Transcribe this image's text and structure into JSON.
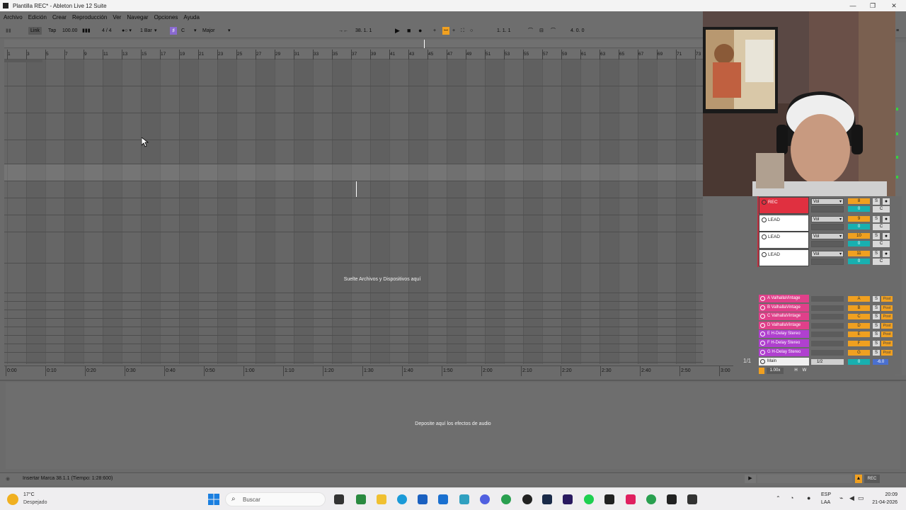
{
  "window": {
    "title": "Plantilla REC* - Ableton Live 12 Suite",
    "controls": [
      "—",
      "❐",
      "✕"
    ]
  },
  "menu": [
    "Archivo",
    "Edición",
    "Crear",
    "Reproducción",
    "Ver",
    "Navegar",
    "Opciones",
    "Ayuda"
  ],
  "control_bar": {
    "link": "Link",
    "tap": "Tap",
    "tempo": "100.00",
    "signature": "4 / 4",
    "quantize": "1 Bar",
    "key": "C",
    "scale": "Major",
    "position": "38.  1.  1",
    "loop_start": "1.  1.  1",
    "loop_length": "4.  0.  0"
  },
  "ruler_ticks": [
    "1",
    "3",
    "5",
    "7",
    "9",
    "11",
    "13",
    "15",
    "17",
    "19",
    "21",
    "23",
    "25",
    "27",
    "29",
    "31",
    "33",
    "35",
    "37",
    "39",
    "41",
    "43",
    "45",
    "47",
    "49",
    "51",
    "53",
    "55",
    "57",
    "59",
    "61",
    "63",
    "65",
    "67",
    "69",
    "71",
    "73"
  ],
  "time_ticks": [
    "0:00",
    "0:10",
    "0:20",
    "0:30",
    "0:40",
    "0:50",
    "1:00",
    "1:10",
    "1:20",
    "1:30",
    "1:40",
    "1:50",
    "2:00",
    "2:10",
    "2:20",
    "2:30",
    "2:40",
    "2:50",
    "3:00"
  ],
  "arrangement": {
    "drop_text": "Suelte Archivos y Dispositivos aquí"
  },
  "tracks": [
    {
      "name": "REC",
      "vol": "Vol",
      "number": "8",
      "value": "0",
      "solo": "S",
      "arm": "●",
      "center": "C",
      "color": "#e03040"
    },
    {
      "name": "LEAD",
      "vol": "Vol",
      "number": "9",
      "value": "0",
      "solo": "S",
      "arm": "●",
      "center": "C",
      "color": "#ffffff"
    },
    {
      "name": "LEAD",
      "vol": "Vol",
      "number": "10",
      "value": "0",
      "solo": "S",
      "arm": "●",
      "center": "C",
      "color": "#ffffff"
    },
    {
      "name": "LEAD",
      "vol": "Vol",
      "number": "11",
      "value": "0",
      "solo": "S",
      "arm": "●",
      "center": "C",
      "color": "#ffffff"
    }
  ],
  "returns": [
    {
      "name": "A ValhallaVintage",
      "letter": "A",
      "solo": "S",
      "post": "Post",
      "color": "#e0408a"
    },
    {
      "name": "B ValhallaVintage",
      "letter": "B",
      "solo": "S",
      "post": "Post",
      "color": "#e0408a"
    },
    {
      "name": "C ValhallaVintage",
      "letter": "C",
      "solo": "S",
      "post": "Post",
      "color": "#e0408a"
    },
    {
      "name": "D ValhallaVintage",
      "letter": "D",
      "solo": "S",
      "post": "Post",
      "color": "#e0408a"
    },
    {
      "name": "E H-Delay Stereo",
      "letter": "E",
      "solo": "S",
      "post": "Post",
      "color": "#b040d0"
    },
    {
      "name": "F H-Delay Stereo",
      "letter": "F",
      "solo": "S",
      "post": "Post",
      "color": "#b040d0"
    },
    {
      "name": "G H-Delay Stereo",
      "letter": "G",
      "solo": "S",
      "post": "Post",
      "color": "#b040d0"
    }
  ],
  "main": {
    "page": "1/1",
    "name": "Main",
    "routing": "1/2",
    "value": "0",
    "gain": "-6.0",
    "zoom": "1.00x",
    "h": "H",
    "w": "W"
  },
  "detail": {
    "drop_text": "Deposite aquí los efectos de audio"
  },
  "status": {
    "message": "Insertar Marca 38.1.1 (Tiempo: 1:28:600)",
    "rec": "REC"
  },
  "taskbar": {
    "temp": "17°C",
    "weather": "Despejado",
    "search": "Buscar",
    "lang": "ESP",
    "lang2": "LAA",
    "time": "20:09",
    "date": "21-04-2026"
  }
}
